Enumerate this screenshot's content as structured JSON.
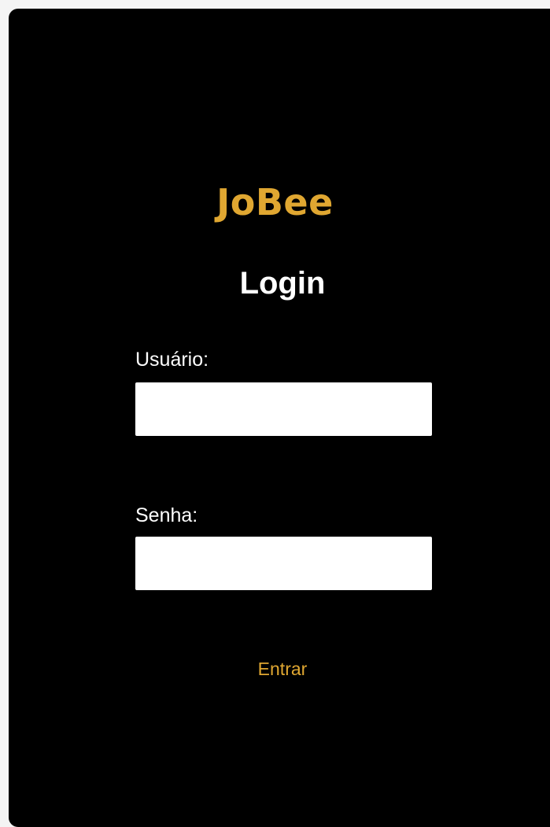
{
  "brand": {
    "name": "JoBee"
  },
  "login": {
    "title": "Login",
    "username_label": "Usuário:",
    "username_value": "",
    "password_label": "Senha:",
    "password_value": "",
    "submit_label": "Entrar"
  },
  "colors": {
    "background": "#000000",
    "accent": "#e0a731",
    "text": "#ffffff",
    "field": "#ffffff"
  }
}
